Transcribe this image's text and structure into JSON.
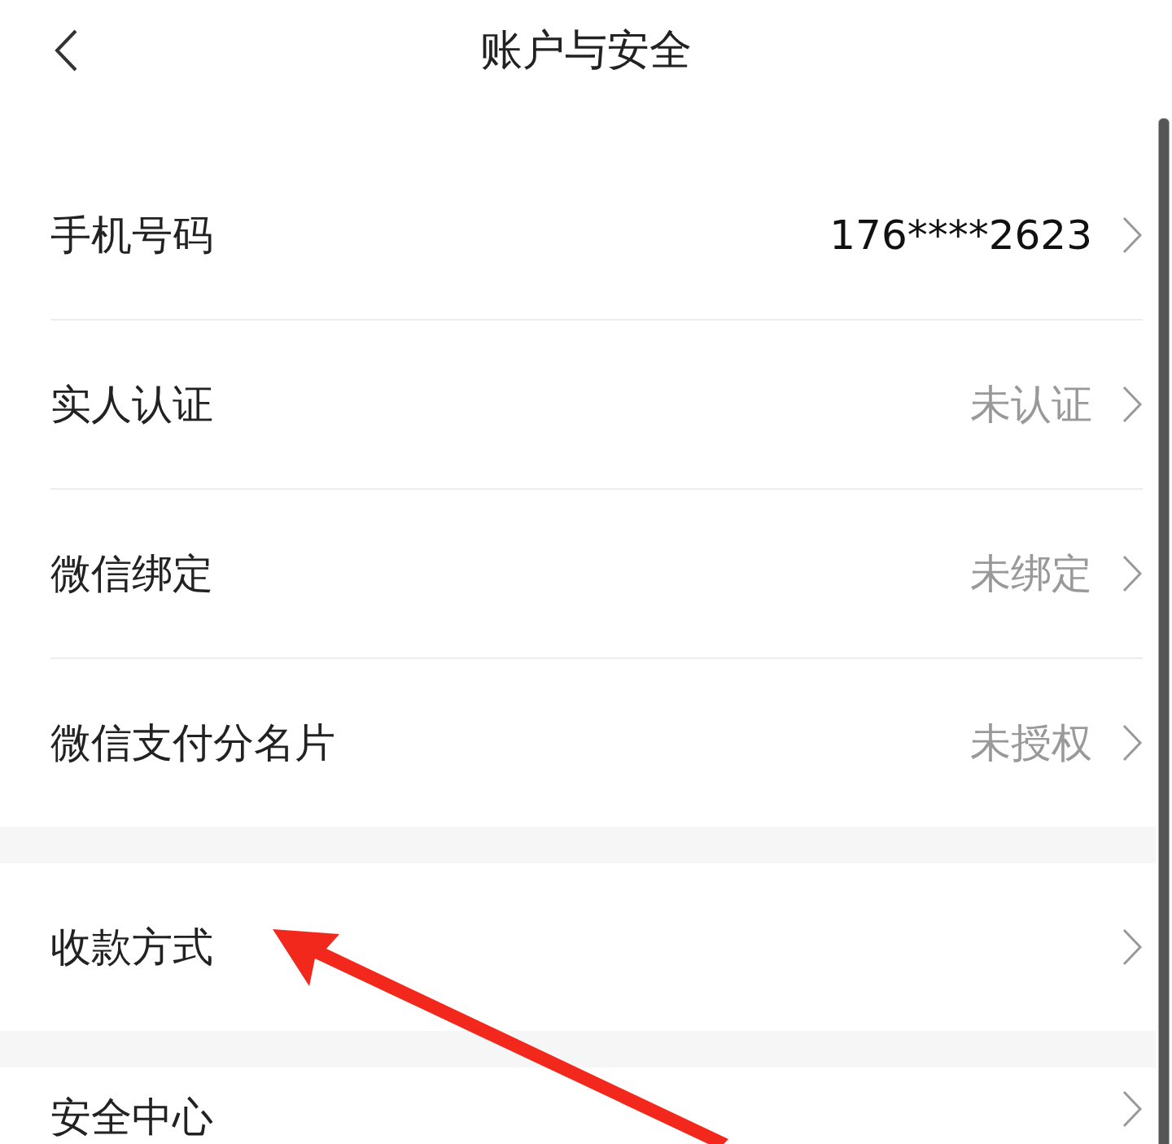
{
  "header": {
    "title": "账户与安全"
  },
  "groups": [
    {
      "rows": [
        {
          "label": "手机号码",
          "value": "176****2623",
          "kind": "info"
        },
        {
          "label": "实人认证",
          "value": "未认证",
          "kind": "status"
        },
        {
          "label": "微信绑定",
          "value": "未绑定",
          "kind": "status"
        },
        {
          "label": "微信支付分名片",
          "value": "未授权",
          "kind": "status"
        }
      ]
    },
    {
      "rows": [
        {
          "label": "收款方式"
        }
      ]
    },
    {
      "rows": [
        {
          "label": "安全中心"
        }
      ]
    }
  ]
}
